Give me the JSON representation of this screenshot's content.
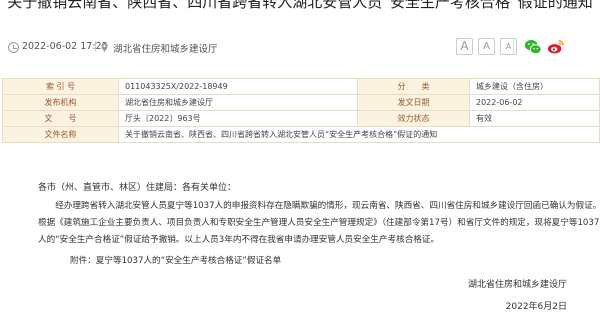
{
  "page_title": "关于撤销云南省、陕西省、四川省跨省转入湖北安管人员“安全生产考核合格”假证的通知",
  "meta": {
    "date": "2022-06-02 17:22",
    "separator": "|",
    "source": "湖北省住房和城乡建设厅"
  },
  "font_size": {
    "large": "A",
    "medium": "A",
    "small": "A"
  },
  "share_icons": [
    "wechat-icon",
    "weibo-icon"
  ],
  "info": {
    "index_label": "索 引 号",
    "index_value": "011043325X/2022-18949",
    "category_label": "分　　类",
    "category_value": "城乡建设（含住房）",
    "issuer_label": "发布机构",
    "issuer_value": "湖北省住房和城乡建设厅",
    "issue_date_label": "发文日期",
    "issue_date_value": "2022-06-02",
    "doc_no_label": "文　　号",
    "doc_no_value": "厅头〔2022〕963号",
    "validity_label": "效力状态",
    "validity_value": "有效",
    "name_label": "文件名称",
    "name_value": "关于撤销云南省、陕西省、四川省跨省转入湖北安管人员“安全生产考核合格”假证的通知"
  },
  "body": {
    "greeting": "各市（州、直管市、林区）住建局：各有关单位：",
    "p1_line1": "经办理跨省转入湖北安管人员夏宁等1037人的申报资料存在隐瞒欺骗的情形，现云南省、陕西省、四川省住房和城乡建设厅回函已确认为假证。",
    "p1_line2": "根据《建筑施工企业主要负责人、项目负责人和专职安全生产管理人员安全生产管理规定》（住建部令第17号）和省厅文件的规定，现将夏宁等1037",
    "p1_line3": "人的“安全生产合格证”假证给予撤销。以上人员3年内不得在我省申请办理安管人员安全生产考核合格证。",
    "attachment": "附件：夏宁等1037人的“安全生产考核合格证”假证名单",
    "signature": "湖北省住房和城乡建设厅",
    "sign_date": "2022年6月2日"
  },
  "colors": {
    "label_bg": "#fbf3df",
    "label_text": "#a2552f",
    "border": "#e7dcc4",
    "wechat": "#2fb62d",
    "weibo": "#e6162d"
  }
}
